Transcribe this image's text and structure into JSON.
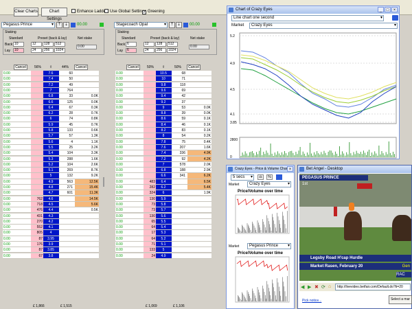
{
  "toolbar": {
    "clear": "Clear Charts",
    "chart_settings": "Chart Settings",
    "enhance": "Enhance Ladder",
    "global": "Use Global Settings",
    "greening": "Greening"
  },
  "left": {
    "runner": "Pegasus Prince",
    "pnl": "00.00",
    "staking": "Staking",
    "standard": "Standard",
    "preset": "Preset (back & lay)",
    "net": "Net stake",
    "back_label": "Back",
    "lay_label": "Lay",
    "back_std": "10",
    "lay_std": "10",
    "presets_back": [
      "12",
      "128",
      "512"
    ],
    "presets_lay": [
      "24",
      "256",
      "1024"
    ],
    "net_value": "0.00",
    "cancel": "Cancel",
    "back_pct": "56%",
    "lay_pct": "44%",
    "arrow": "⇧",
    "matched_back": "£ 1,866",
    "matched_lay": "£ 1,515",
    "rows": [
      [
        "0.00",
        "",
        "7.6",
        "60",
        ""
      ],
      [
        "0.00",
        "",
        "7.4",
        "50",
        ""
      ],
      [
        "0.00",
        "",
        "7.2",
        "49",
        ""
      ],
      [
        "0.00",
        "",
        "7",
        "764",
        ""
      ],
      [
        "0.00",
        "",
        "6.8",
        "33",
        "0.0K"
      ],
      [
        "0.00",
        "",
        "6.6",
        "125",
        "0.0K"
      ],
      [
        "0.00",
        "",
        "6.4",
        "67",
        "0.3K"
      ],
      [
        "0.00",
        "",
        "6.2",
        "28",
        "0.7K"
      ],
      [
        "0.00",
        "",
        "6",
        "74",
        "0.8K"
      ],
      [
        "0.00",
        "",
        "5.9",
        "45",
        "0.7K"
      ],
      [
        "0.00",
        "",
        "5.8",
        "133",
        "0.6K"
      ],
      [
        "0.00",
        "",
        "5.7",
        "57",
        "1.3K"
      ],
      [
        "0.00",
        "",
        "5.6",
        "4",
        "1.1K"
      ],
      [
        "0.00",
        "",
        "5.5",
        "25",
        "3.2K"
      ],
      [
        "0.00",
        "",
        "5.4",
        "104",
        "3.3K"
      ],
      [
        "0.00",
        "",
        "5.3",
        "288",
        "1.6K"
      ],
      [
        "0.00",
        "",
        "5.2",
        "104",
        "2.6K"
      ],
      [
        "0.00",
        "",
        "5.1",
        "269",
        "8.7K"
      ],
      [
        "0.00",
        "",
        "5",
        "132",
        "9.2K"
      ],
      [
        "0.00",
        "",
        "4.9",
        "563",
        "12.5K"
      ],
      [
        "0.00",
        "",
        "4.8",
        "271",
        "15.4K"
      ],
      [
        "0.00",
        "",
        "4.7",
        "601",
        "11.3K"
      ],
      [
        "0.00",
        "762",
        "4.6",
        "",
        "14.5K"
      ],
      [
        "0.00",
        "718",
        "4.5",
        "",
        "5.6K"
      ],
      [
        "0.00",
        "476",
        "4.4",
        "",
        "0.5K"
      ],
      [
        "0.00",
        "431",
        "4.3",
        "",
        ""
      ],
      [
        "0.00",
        "270",
        "4.2",
        "",
        ""
      ],
      [
        "0.00",
        "552",
        "4.1",
        "",
        ""
      ],
      [
        "0.00",
        "805",
        "4",
        "",
        ""
      ],
      [
        "0.00",
        "87",
        "3.95",
        "",
        ""
      ],
      [
        "0.00",
        "176",
        "3.9",
        "",
        ""
      ],
      [
        "0.00",
        "87",
        "3.85",
        "",
        ""
      ],
      [
        "0.00",
        "67",
        "3.8",
        "",
        ""
      ]
    ],
    "orange": [
      19,
      20,
      21,
      22,
      23
    ]
  },
  "right": {
    "runner": "Stagecoach Opal",
    "pnl": "00.00",
    "staking": "Staking",
    "standard": "Standard",
    "preset": "Preset (back & lay)",
    "net": "Net stake",
    "back_label": "Back",
    "lay_label": "Lay",
    "back_std": "6",
    "lay_std": "6",
    "presets_back": [
      "12",
      "128",
      "512"
    ],
    "presets_lay": [
      "24",
      "256",
      "1024"
    ],
    "net_value": "0.00",
    "cancel": "Cancel",
    "back_pct": "50%",
    "lay_pct": "50%",
    "arrow": "⇧",
    "matched_back": "£ 1,069",
    "matched_lay": "£ 1,106",
    "rows": [
      [
        "0.00",
        "",
        "10.5",
        "68",
        ""
      ],
      [
        "0.00",
        "",
        "10",
        "71",
        ""
      ],
      [
        "0.00",
        "",
        "9.8",
        "118",
        ""
      ],
      [
        "0.00",
        "",
        "9.6",
        "69",
        ""
      ],
      [
        "0.00",
        "",
        "9.4",
        "42",
        ""
      ],
      [
        "0.00",
        "",
        "9.2",
        "37",
        ""
      ],
      [
        "0.00",
        "",
        "9",
        "53",
        "0.0K"
      ],
      [
        "0.00",
        "",
        "8.8",
        "39",
        "0.0K"
      ],
      [
        "0.00",
        "",
        "8.6",
        "59",
        "0.1K"
      ],
      [
        "0.00",
        "",
        "8.4",
        "46",
        "0.1K"
      ],
      [
        "0.00",
        "",
        "8.2",
        "83",
        "0.1K"
      ],
      [
        "0.00",
        "",
        "8",
        "54",
        "0.2K"
      ],
      [
        "0.00",
        "",
        "7.8",
        "75",
        "0.4K"
      ],
      [
        "0.00",
        "",
        "7.6",
        "207",
        "1.6K"
      ],
      [
        "0.00",
        "",
        "7.4",
        "336",
        "4.9K"
      ],
      [
        "0.00",
        "",
        "7.2",
        "92",
        "4.2K"
      ],
      [
        "0.00",
        "",
        "7",
        "578",
        "2.0K"
      ],
      [
        "0.00",
        "",
        "6.8",
        "188",
        "2.9K"
      ],
      [
        "0.00",
        "",
        "6.6",
        "341",
        "6.2K"
      ],
      [
        "0.00",
        "483",
        "6.4",
        "",
        "6.5K"
      ],
      [
        "0.00",
        "282",
        "6.2",
        "",
        "5.4K"
      ],
      [
        "0.00",
        "324",
        "6",
        "",
        "1.9K"
      ],
      [
        "0.00",
        "130",
        "5.9",
        "",
        ""
      ],
      [
        "0.00",
        "73",
        "5.8",
        "",
        ""
      ],
      [
        "0.00",
        "73",
        "5.7",
        "",
        ""
      ],
      [
        "0.00",
        "130",
        "5.6",
        "",
        ""
      ],
      [
        "0.00",
        "65",
        "5.5",
        "",
        ""
      ],
      [
        "0.00",
        "64",
        "5.4",
        "",
        ""
      ],
      [
        "0.00",
        "17",
        "5.3",
        "",
        ""
      ],
      [
        "0.00",
        "64",
        "5.2",
        "",
        ""
      ],
      [
        "0.00",
        "71",
        "5.1",
        "",
        ""
      ],
      [
        "0.00",
        "133",
        "5",
        "",
        ""
      ],
      [
        "0.00",
        "24",
        "4.9",
        "",
        ""
      ]
    ],
    "orange": [
      14,
      15,
      18,
      19,
      20
    ]
  },
  "chart1": {
    "title": "Chart of Crazy Eyes",
    "mode": "Line chart one second",
    "market_label": "Market",
    "market_value": "Crazy Eyes",
    "yticks": [
      "5.2",
      "4.9",
      "4.5",
      "4.1",
      "3.85"
    ],
    "vticks": [
      "2800",
      "0"
    ]
  },
  "chart2": {
    "title": "Crazy Eyes - Price & Volume Chart",
    "interval": "5 secs",
    "market_label": "Market",
    "market_value": "Crazy Eyes",
    "chart_title": "Price/Volume over time"
  },
  "chart3": {
    "market_label": "Market",
    "market_value": "Pegasus Prince",
    "chart_title": "Price/Volume over time"
  },
  "video": {
    "title": "Bet Angel - Desktop",
    "horse": "PEGASUS PRINCE",
    "position": "1st",
    "race": "Legsby Road H'cap Hurdle",
    "venue": "Market Rasen, February 20",
    "url": "http://livevideo.betfair.com/Default.do?ti=20",
    "pick": "Pick notice...",
    "select": "Select a mar",
    "brand": "RAC",
    "tag": "Gen"
  },
  "colors": {
    "ladder_blue": "#0015c8",
    "pink": "#ffc0cb",
    "orange": "#f5b87a",
    "green": "#009900"
  }
}
